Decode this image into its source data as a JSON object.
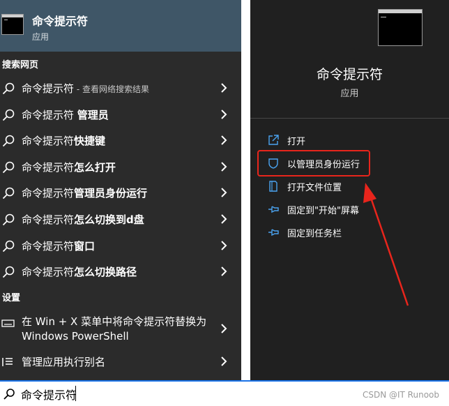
{
  "best_match": {
    "title": "命令提示符",
    "subtitle": "应用"
  },
  "search_web": {
    "heading": "搜索网页",
    "items": [
      {
        "normal": "命令提示符",
        "muted": " - 查看网络搜索结果",
        "bold": ""
      },
      {
        "normal": "命令提示符 ",
        "muted": "",
        "bold": "管理员"
      },
      {
        "normal": "命令提示符",
        "muted": "",
        "bold": "快捷键"
      },
      {
        "normal": "命令提示符",
        "muted": "",
        "bold": "怎么打开"
      },
      {
        "normal": "命令提示符",
        "muted": "",
        "bold": "管理员身份运行"
      },
      {
        "normal": "命令提示符",
        "muted": "",
        "bold": "怎么切换到d盘"
      },
      {
        "normal": "命令提示符",
        "muted": "",
        "bold": "窗口"
      },
      {
        "normal": "命令提示符",
        "muted": "",
        "bold": "怎么切换路径"
      }
    ]
  },
  "settings": {
    "heading": "设置",
    "items": [
      {
        "label": "在 Win + X 菜单中将命令提示符替换为 Windows PowerShell",
        "icon": "keyboard-icon"
      },
      {
        "label": "管理应用执行别名",
        "icon": "list-settings-icon"
      }
    ]
  },
  "preview": {
    "title": "命令提示符",
    "subtitle": "应用",
    "actions": [
      {
        "label": "打开",
        "icon": "open-icon"
      },
      {
        "label": "以管理员身份运行",
        "icon": "shield-icon"
      },
      {
        "label": "打开文件位置",
        "icon": "file-location-icon"
      },
      {
        "label": "固定到\"开始\"屏幕",
        "icon": "pin-icon"
      },
      {
        "label": "固定到任务栏",
        "icon": "pin-icon"
      }
    ]
  },
  "search": {
    "value": "命令提示符"
  },
  "watermark": "CSDN @IT Runoob",
  "colors": {
    "accent": "#1a73e8",
    "annotation_red": "#e8251c",
    "best_match_bg": "#3f5667"
  }
}
